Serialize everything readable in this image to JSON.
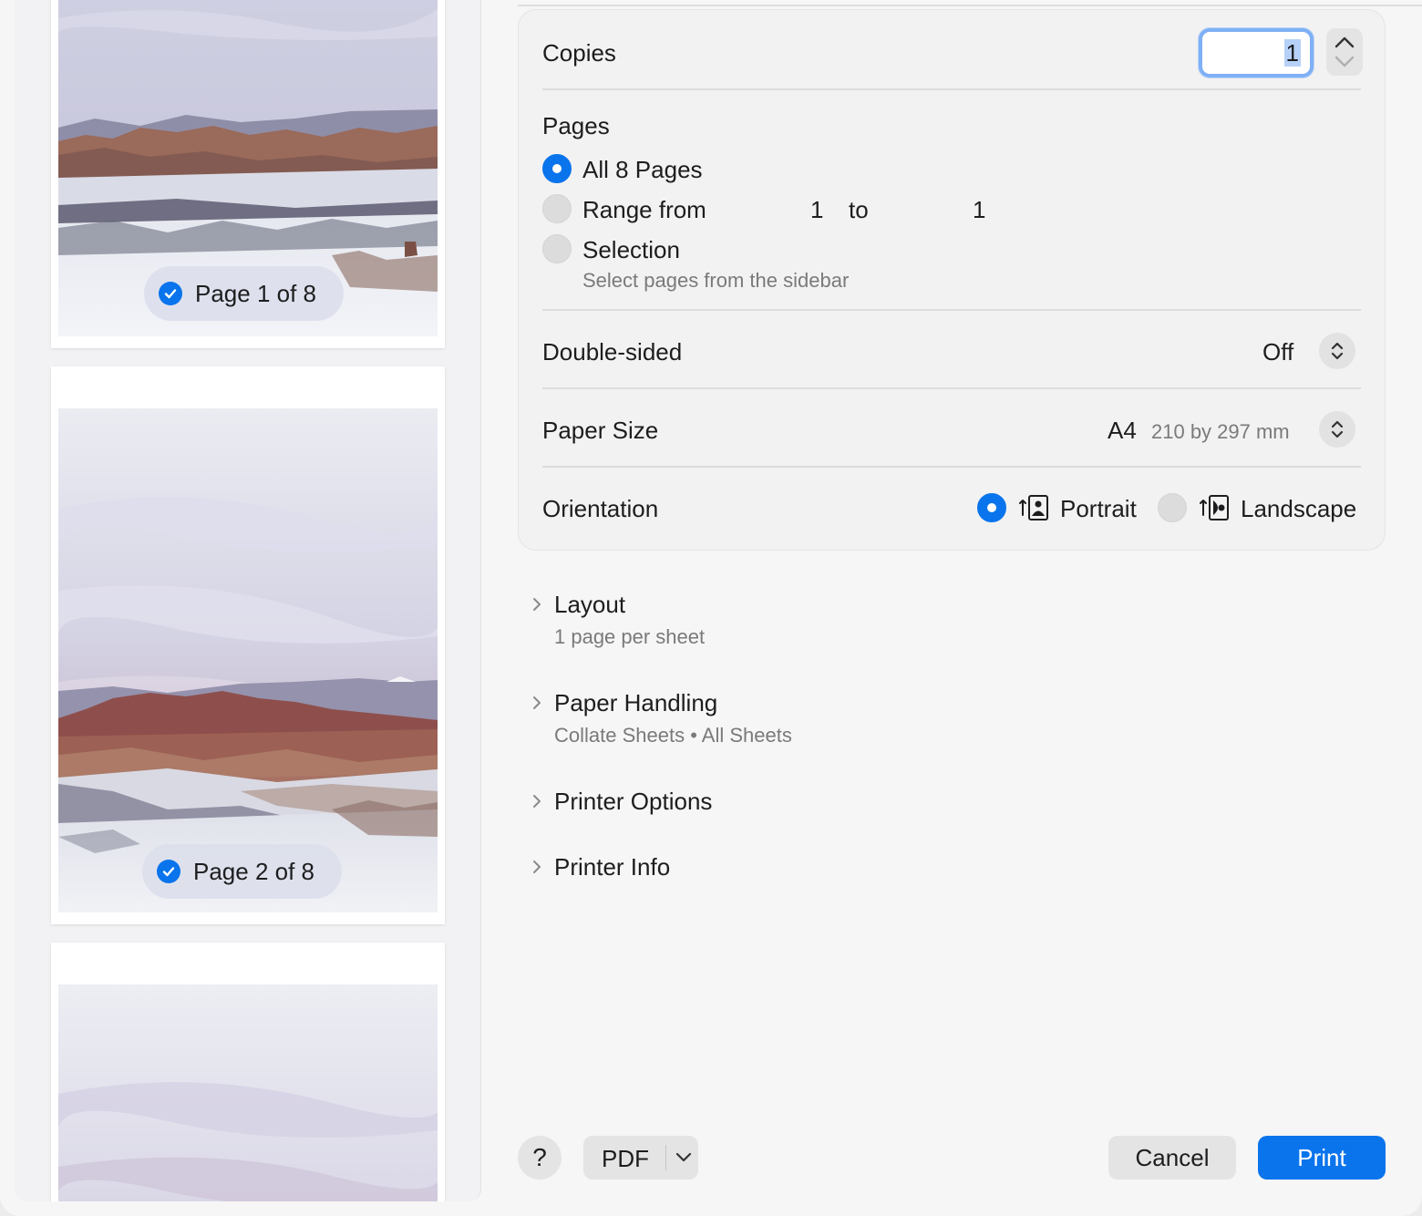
{
  "sidebar": {
    "pages": [
      {
        "label": "Page 1 of 8",
        "selected": true
      },
      {
        "label": "Page 2 of 8",
        "selected": true
      }
    ]
  },
  "copies": {
    "label": "Copies",
    "value": "1"
  },
  "pages": {
    "label": "Pages",
    "all_label": "All 8 Pages",
    "range_label": "Range from",
    "range_from": "1",
    "range_to_label": "to",
    "range_to": "1",
    "selection_label": "Selection",
    "selection_hint": "Select pages from the sidebar",
    "selected_option": "all"
  },
  "double_sided": {
    "label": "Double-sided",
    "value": "Off"
  },
  "paper_size": {
    "label": "Paper Size",
    "value": "A4",
    "detail": "210 by 297 mm"
  },
  "orientation": {
    "label": "Orientation",
    "portrait_label": "Portrait",
    "landscape_label": "Landscape",
    "selected": "portrait"
  },
  "sections": [
    {
      "title": "Layout",
      "desc": "1 page per sheet"
    },
    {
      "title": "Paper Handling",
      "desc": "Collate Sheets • All Sheets"
    },
    {
      "title": "Printer Options",
      "desc": ""
    },
    {
      "title": "Printer Info",
      "desc": ""
    }
  ],
  "footer": {
    "help_label": "?",
    "pdf_label": "PDF",
    "cancel_label": "Cancel",
    "print_label": "Print"
  },
  "colors": {
    "accent": "#0a74ec",
    "background": "#f6f6f6",
    "focus_ring": "#7fb0f5"
  },
  "icons": [
    "checkmark-icon",
    "chevron-up-icon",
    "chevron-down-icon",
    "popup-arrows-icon",
    "portrait-icon",
    "landscape-icon",
    "disclosure-chevron-icon",
    "dropdown-chevron-icon"
  ]
}
